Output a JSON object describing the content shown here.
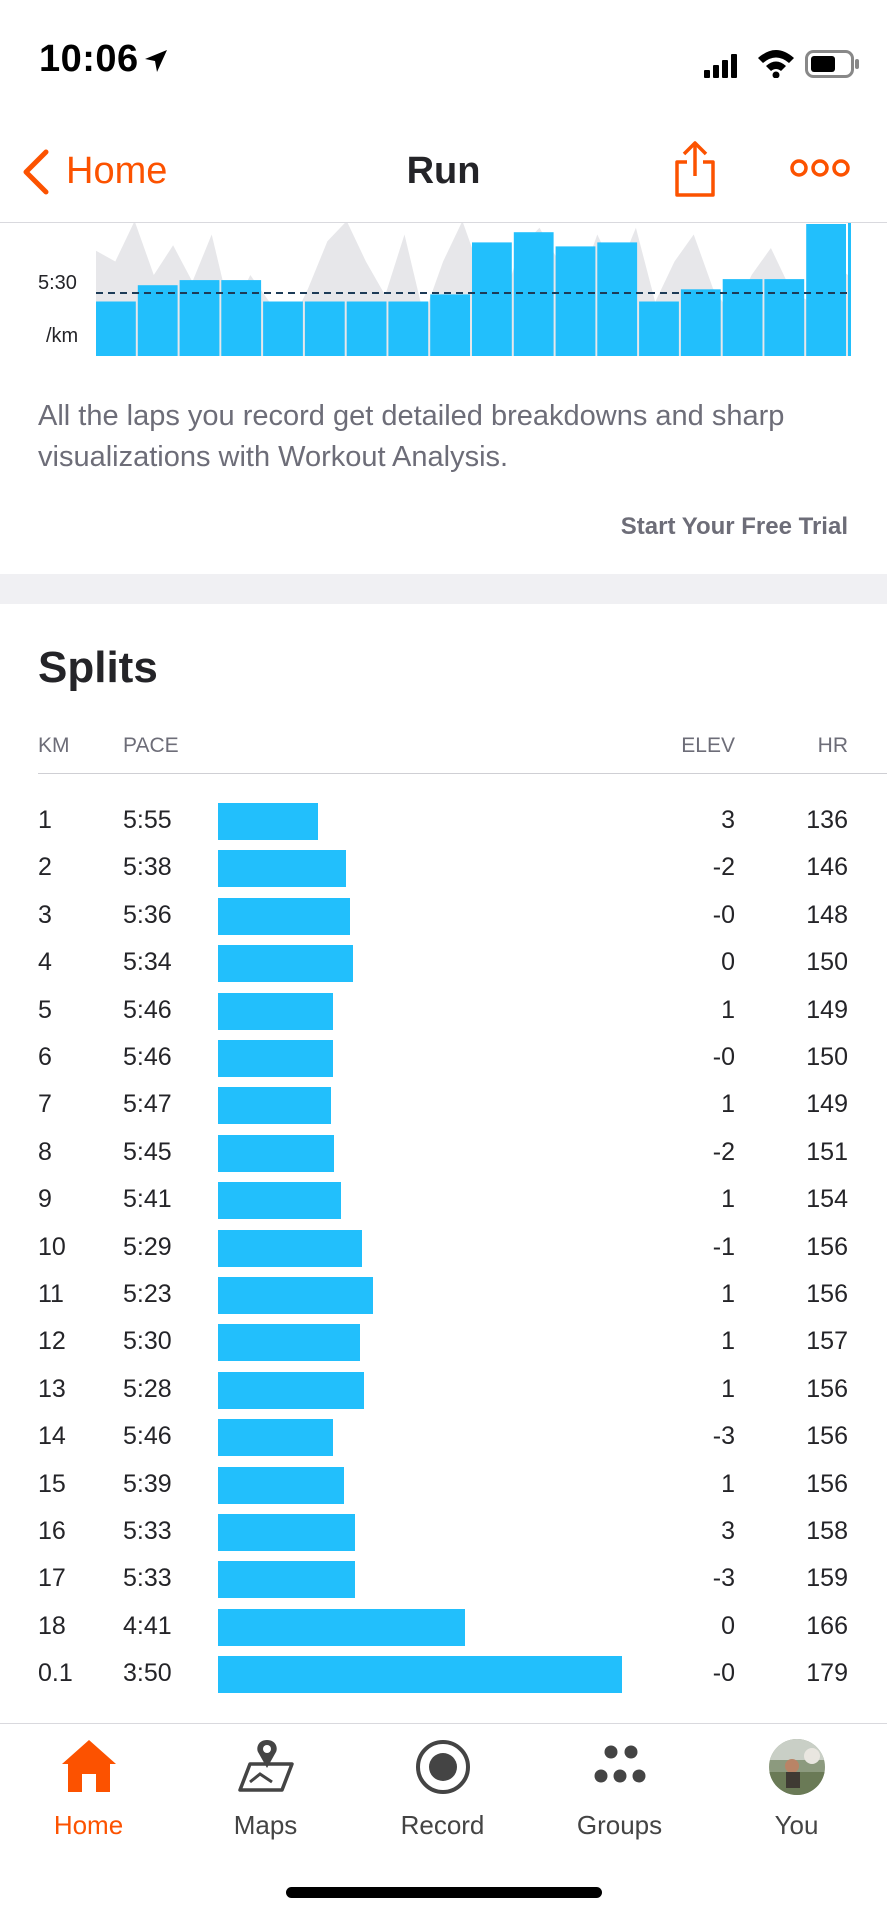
{
  "status_bar": {
    "time": "10:06"
  },
  "nav": {
    "back_label": "Home",
    "title": "Run"
  },
  "lap_chart": {
    "y_tick_value": "5:30",
    "y_tick_unit": "/km",
    "accent_color": "#22bffc",
    "reference_pace": "5:30",
    "lap_levels": [
      0.24,
      0.4,
      0.45,
      0.45,
      0.24,
      0.24,
      0.24,
      0.24,
      0.31,
      0.82,
      0.92,
      0.78,
      0.82,
      0.24,
      0.36,
      0.46,
      0.46,
      1.0
    ]
  },
  "promo": {
    "text": "All the laps you record get detailed breakdowns and sharp visualizations with Workout Analysis.",
    "cta": "Start Your Free Trial"
  },
  "splits": {
    "title": "Splits",
    "headers": {
      "km": "KM",
      "pace": "PACE",
      "elev": "ELEV",
      "hr": "HR"
    },
    "rows": [
      {
        "km": "1",
        "pace": "5:55",
        "elev": "3",
        "hr": "136"
      },
      {
        "km": "2",
        "pace": "5:38",
        "elev": "-2",
        "hr": "146"
      },
      {
        "km": "3",
        "pace": "5:36",
        "elev": "-0",
        "hr": "148"
      },
      {
        "km": "4",
        "pace": "5:34",
        "elev": "0",
        "hr": "150"
      },
      {
        "km": "5",
        "pace": "5:46",
        "elev": "1",
        "hr": "149"
      },
      {
        "km": "6",
        "pace": "5:46",
        "elev": "-0",
        "hr": "150"
      },
      {
        "km": "7",
        "pace": "5:47",
        "elev": "1",
        "hr": "149"
      },
      {
        "km": "8",
        "pace": "5:45",
        "elev": "-2",
        "hr": "151"
      },
      {
        "km": "9",
        "pace": "5:41",
        "elev": "1",
        "hr": "154"
      },
      {
        "km": "10",
        "pace": "5:29",
        "elev": "-1",
        "hr": "156"
      },
      {
        "km": "11",
        "pace": "5:23",
        "elev": "1",
        "hr": "156"
      },
      {
        "km": "12",
        "pace": "5:30",
        "elev": "1",
        "hr": "157"
      },
      {
        "km": "13",
        "pace": "5:28",
        "elev": "1",
        "hr": "156"
      },
      {
        "km": "14",
        "pace": "5:46",
        "elev": "-3",
        "hr": "156"
      },
      {
        "km": "15",
        "pace": "5:39",
        "elev": "1",
        "hr": "156"
      },
      {
        "km": "16",
        "pace": "5:33",
        "elev": "3",
        "hr": "158"
      },
      {
        "km": "17",
        "pace": "5:33",
        "elev": "-3",
        "hr": "159"
      },
      {
        "km": "18",
        "pace": "4:41",
        "elev": "0",
        "hr": "166"
      },
      {
        "km": "0.1",
        "pace": "3:50",
        "elev": "-0",
        "hr": "179"
      }
    ]
  },
  "tab_bar": {
    "active_color": "#fc5200",
    "tabs": [
      {
        "label": "Home",
        "icon": "home-icon"
      },
      {
        "label": "Maps",
        "icon": "maps-icon"
      },
      {
        "label": "Record",
        "icon": "record-icon"
      },
      {
        "label": "Groups",
        "icon": "groups-icon"
      },
      {
        "label": "You",
        "icon": "avatar"
      }
    ]
  }
}
